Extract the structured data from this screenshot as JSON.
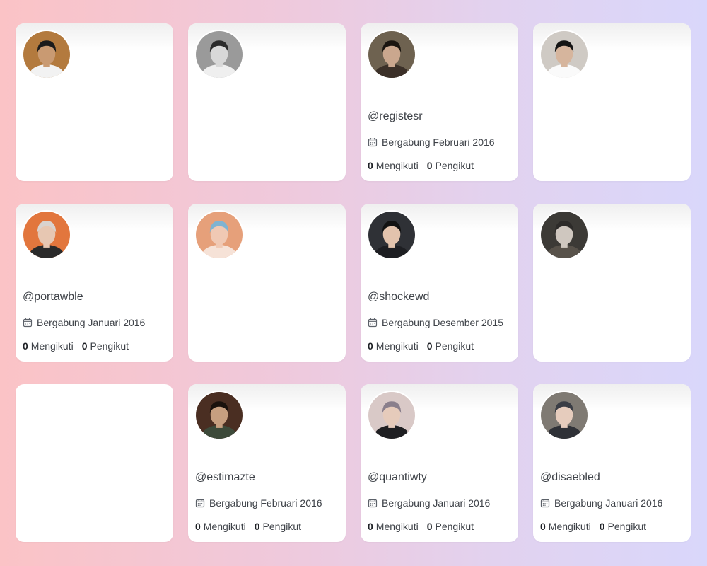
{
  "colors": {
    "card": "#ffffff",
    "text": "#3e4248"
  },
  "cards": [
    {
      "has_avatar": true,
      "has_info": false,
      "skin": "#c99a72",
      "bg": "#b37a3e",
      "hair": "#1b1b1b",
      "shirt": "#f2f2f2"
    },
    {
      "has_avatar": true,
      "has_info": false,
      "skin": "#d8d8d8",
      "bg": "#9a9a9a",
      "hair": "#2a2a2a",
      "shirt": "#efefef"
    },
    {
      "has_avatar": true,
      "has_info": true,
      "skin": "#caa78e",
      "bg": "#6e6250",
      "hair": "#1a1510",
      "shirt": "#3b3028",
      "handle": "@registesr",
      "joined": "Bergabung Februari 2016",
      "following_count": "0",
      "following_label": "Mengikuti",
      "followers_count": "0",
      "followers_label": "Pengikut"
    },
    {
      "has_avatar": true,
      "has_info": false,
      "skin": "#d6b59d",
      "bg": "#cfcac4",
      "hair": "#151515",
      "shirt": "#fafafa"
    },
    {
      "has_avatar": true,
      "has_info": true,
      "skin": "#e7c7b2",
      "bg": "#e2763d",
      "hair": "#d9d3cf",
      "shirt": "#2a2a2a",
      "handle": "@portawble",
      "joined": "Bergabung Januari 2016",
      "following_count": "0",
      "following_label": "Mengikuti",
      "followers_count": "0",
      "followers_label": "Pengikut"
    },
    {
      "has_avatar": true,
      "has_info": false,
      "skin": "#f0c9b4",
      "bg": "#e6a07a",
      "hair": "#7fb3d1",
      "shirt": "#f6e2d7"
    },
    {
      "has_avatar": true,
      "has_info": true,
      "skin": "#e3c3ad",
      "bg": "#2f3136",
      "hair": "#121212",
      "shirt": "#1d1e22",
      "handle": "@shockewd",
      "joined": "Bergabung Desember 2015",
      "following_count": "0",
      "following_label": "Mengikuti",
      "followers_count": "0",
      "followers_label": "Pengikut"
    },
    {
      "has_avatar": true,
      "has_info": false,
      "skin": "#cfc7bf",
      "bg": "#3c3a36",
      "hair": "#2d2b29",
      "shirt": "#58524a"
    },
    {
      "has_avatar": false,
      "has_info": false
    },
    {
      "has_avatar": true,
      "has_info": true,
      "skin": "#c79f80",
      "bg": "#4a2e22",
      "hair": "#1a120d",
      "shirt": "#3d4a3a",
      "handle": "@estimazte",
      "joined": "Bergabung Februari 2016",
      "following_count": "0",
      "following_label": "Mengikuti",
      "followers_count": "0",
      "followers_label": "Pengikut"
    },
    {
      "has_avatar": true,
      "has_info": true,
      "skin": "#e6cbbb",
      "bg": "#d9c9c7",
      "hair": "#8a7f8c",
      "shirt": "#1f1f22",
      "handle": "@quantiwty",
      "joined": "Bergabung Januari 2016",
      "following_count": "0",
      "following_label": "Mengikuti",
      "followers_count": "0",
      "followers_label": "Pengikut"
    },
    {
      "has_avatar": true,
      "has_info": true,
      "skin": "#e6ccbd",
      "bg": "#7f7a73",
      "hair": "#3a3d45",
      "shirt": "#2f3137",
      "handle": "@disaebled",
      "joined": "Bergabung Januari 2016",
      "following_count": "0",
      "following_label": "Mengikuti",
      "followers_count": "0",
      "followers_label": "Pengikut"
    }
  ]
}
